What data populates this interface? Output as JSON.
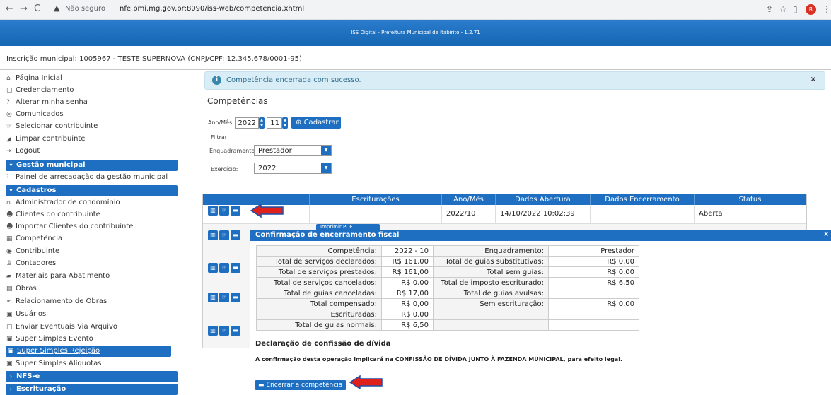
{
  "browser": {
    "security_label": "Não seguro",
    "url": "nfe.pmi.mg.gov.br:8090/iss-web/competencia.xhtml",
    "profile_initial": "R"
  },
  "app": {
    "title": "ISS Digital - Prefeitura Municipal de Itabirito - 1.2.71"
  },
  "inscricao": "Inscrição municipal: 1005967 - TESTE SUPERNOVA (CNPJ/CPF: 12.345.678/0001-95)",
  "sidebar": {
    "top_items": [
      {
        "label": "Página Inicial",
        "icon": "home-icon"
      },
      {
        "label": "Credenciamento",
        "icon": "document-icon"
      },
      {
        "label": "Alterar minha senha",
        "icon": "question-icon"
      },
      {
        "label": "Comunicados",
        "icon": "chat-icon"
      },
      {
        "label": "Selecionar contribuinte",
        "icon": "hand-icon"
      },
      {
        "label": "Limpar contribuinte",
        "icon": "eraser-icon"
      },
      {
        "label": "Logout",
        "icon": "logout-icon"
      }
    ],
    "gestao": {
      "label": "Gestão municipal",
      "items": [
        {
          "label": "Painel de arrecadação da gestão municipal",
          "icon": "chart-icon"
        }
      ]
    },
    "cadastros": {
      "label": "Cadastros",
      "items": [
        {
          "label": "Administrador de condomínio",
          "icon": "home-icon"
        },
        {
          "label": "Clientes do contribuinte",
          "icon": "users-icon"
        },
        {
          "label": "Importar Clientes do contribuinte",
          "icon": "users-icon"
        },
        {
          "label": "Competência",
          "icon": "calendar-icon"
        },
        {
          "label": "Contribuinte",
          "icon": "user-circle-icon"
        },
        {
          "label": "Contadores",
          "icon": "user-icon"
        },
        {
          "label": "Materiais para Abatimento",
          "icon": "book-icon"
        },
        {
          "label": "Obras",
          "icon": "building-icon"
        },
        {
          "label": "Relacionamento de Obras",
          "icon": "link-icon"
        },
        {
          "label": "Usuários",
          "icon": "id-card-icon"
        },
        {
          "label": "Enviar Eventuais Via Arquivo",
          "icon": "file-icon"
        },
        {
          "label": "Super Simples Evento",
          "icon": "window-icon"
        },
        {
          "label": "Super Simples Rejeição",
          "icon": "window-icon"
        },
        {
          "label": "Super Simples Alíquotas",
          "icon": "window-icon"
        }
      ]
    },
    "nfse": {
      "label": "NFS-e"
    },
    "escrituracao": {
      "label": "Escrituração"
    }
  },
  "alert": {
    "text": "Competência encerrada com sucesso.",
    "close": "×",
    "icon": "info-icon"
  },
  "competencias": {
    "title": "Competências",
    "ano_mes_label": "Ano/Mês:",
    "ano": "2022",
    "mes": "11",
    "cadastrar_label": "Cadastrar",
    "filtrar_label": "Filtrar",
    "enquadramento_label": "Enquadramento:",
    "enquadramento_value": "Prestador",
    "exercicio_label": "Exercício:",
    "exercicio_value": "2022"
  },
  "table": {
    "headers": [
      "Escriturações",
      "Ano/Mês",
      "Dados Abertura",
      "Dados Encerramento",
      "Status"
    ],
    "rows": [
      {
        "escrituracoes": "",
        "ano_mes": "2022/10",
        "abertura": "14/10/2022 10:02:39",
        "encerramento": "",
        "status": "Aberta"
      }
    ],
    "partial_button": "Imprimir PDF"
  },
  "dialog": {
    "title": "Confirmação de encerramento fiscal",
    "close": "×",
    "summary": [
      [
        "Competência:",
        "2022 - 10",
        "Enquadramento:",
        "Prestador"
      ],
      [
        "Total de serviços declarados:",
        "R$ 161,00",
        "Total de guias substitutivas:",
        "R$ 0,00"
      ],
      [
        "Total de serviços prestados:",
        "R$ 161,00",
        "Total sem guias:",
        "R$ 0,00"
      ],
      [
        "Total de serviços cancelados:",
        "R$ 0,00",
        "Total de imposto escriturado:",
        "R$ 6,50"
      ],
      [
        "Total de guias canceladas:",
        "R$ 17,00",
        "Total de guias avulsas:",
        ""
      ],
      [
        "Total compensado:",
        "R$ 0,00",
        "Sem escrituração:",
        "R$ 0,00"
      ],
      [
        "Escrituradas:",
        "R$ 0,00",
        "",
        ""
      ],
      [
        "Total de guias normais:",
        "R$ 6,50",
        "",
        ""
      ]
    ],
    "declaracao_title": "Declaração de confissão de dívida",
    "declaracao_text": "A confirmação desta operação implicará na CONFISSÃO DE DÍVIDA JUNTO À FAZENDA MUNICIPAL, para efeito legal.",
    "encerrar_label": "Encerrar a competência"
  },
  "colors": {
    "primary": "#1e6fc2",
    "alert_bg": "#d9edf7",
    "arrow": "#e0201b"
  }
}
